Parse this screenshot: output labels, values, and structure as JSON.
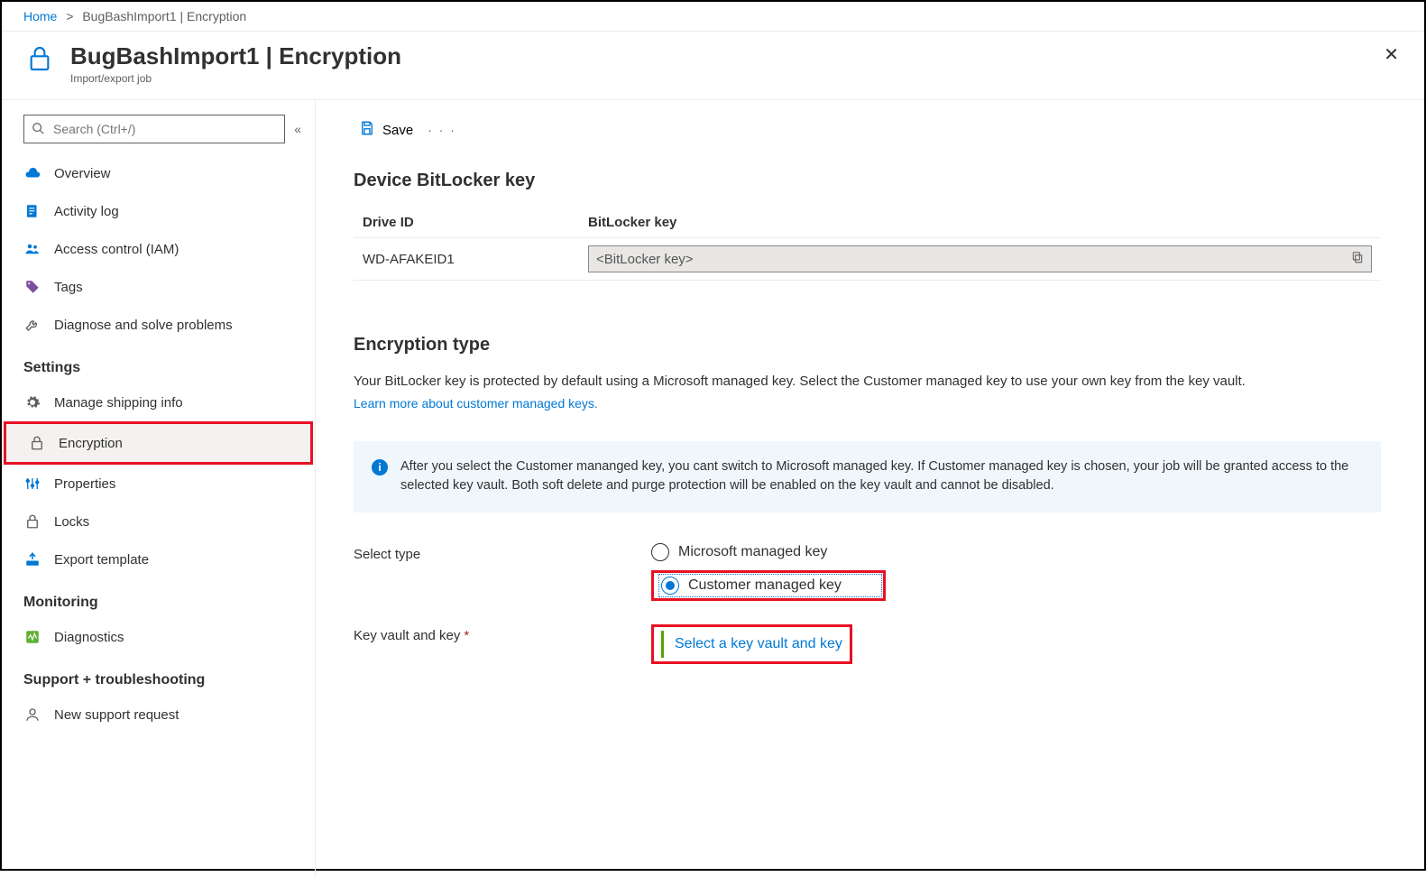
{
  "breadcrumb": {
    "home": "Home",
    "current": "BugBashImport1 | Encryption"
  },
  "header": {
    "title": "BugBashImport1 | Encryption",
    "subtitle": "Import/export job"
  },
  "search": {
    "placeholder": "Search (Ctrl+/)"
  },
  "sidebar": {
    "items": [
      {
        "label": "Overview"
      },
      {
        "label": "Activity log"
      },
      {
        "label": "Access control (IAM)"
      },
      {
        "label": "Tags"
      },
      {
        "label": "Diagnose and solve problems"
      }
    ],
    "settings_header": "Settings",
    "settings": [
      {
        "label": "Manage shipping info"
      },
      {
        "label": "Encryption"
      },
      {
        "label": "Properties"
      },
      {
        "label": "Locks"
      },
      {
        "label": "Export template"
      }
    ],
    "monitoring_header": "Monitoring",
    "monitoring": [
      {
        "label": "Diagnostics"
      }
    ],
    "support_header": "Support + troubleshooting",
    "support": [
      {
        "label": "New support request"
      }
    ]
  },
  "toolbar": {
    "save": "Save"
  },
  "bitlocker": {
    "heading": "Device BitLocker key",
    "col_drive": "Drive ID",
    "col_key": "BitLocker key",
    "rows": [
      {
        "drive": "WD-AFAKEID1",
        "key": "<BitLocker key>"
      }
    ]
  },
  "encryption": {
    "heading": "Encryption type",
    "desc": "Your BitLocker key is protected by default using a Microsoft managed key. Select the Customer managed key to use your own key from the key vault.",
    "learn_link": "Learn more about customer managed keys.",
    "info": "After you select the Customer mananged key, you cant switch to Microsoft managed key. If Customer managed key is chosen, your job will be granted access to the selected key vault. Both soft delete and purge protection will be enabled on the key vault and cannot be disabled.",
    "select_type_label": "Select type",
    "opt_ms": "Microsoft managed key",
    "opt_cust": "Customer managed key",
    "kv_label": "Key vault and key",
    "kv_link": "Select a key vault and key"
  }
}
